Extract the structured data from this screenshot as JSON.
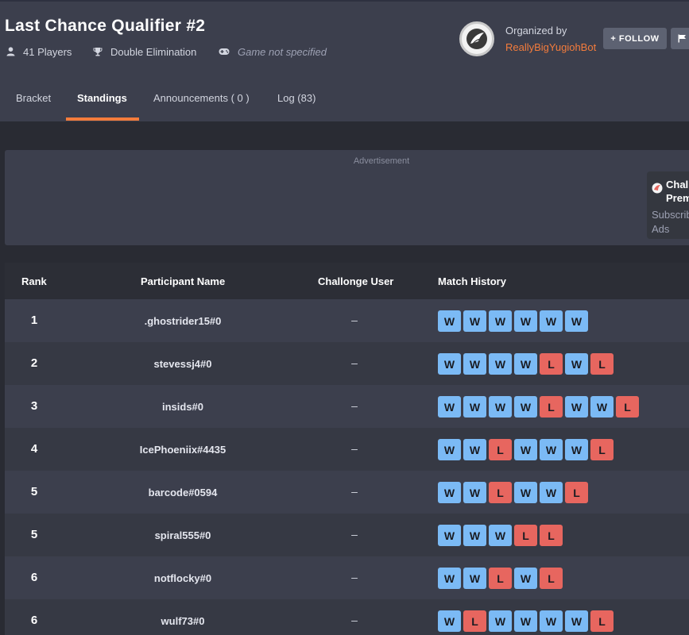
{
  "tournament": {
    "title": "Last Chance Qualifier #2",
    "players": "41 Players",
    "format": "Double Elimination",
    "game": "Game not specified"
  },
  "organizer": {
    "label": "Organized by",
    "name": "ReallyBigYugiohBot",
    "follow_label": "+ FOLLOW"
  },
  "tabs": [
    {
      "label": "Bracket",
      "active": false
    },
    {
      "label": "Standings",
      "active": true
    },
    {
      "label": "Announcements ( 0 )",
      "active": false
    },
    {
      "label": "Log (83)",
      "active": false
    }
  ],
  "ad": {
    "label": "Advertisement",
    "promo_title_1": "Chal",
    "promo_title_2": "Prem",
    "promo_sub_1": "Subscrib",
    "promo_sub_2": "Ads"
  },
  "standings": {
    "headers": {
      "rank": "Rank",
      "name": "Participant Name",
      "user": "Challonge User",
      "history": "Match History"
    },
    "rows": [
      {
        "rank": "1",
        "name": ".ghostrider15#0",
        "user": "–",
        "history": [
          "W",
          "W",
          "W",
          "W",
          "W",
          "W"
        ]
      },
      {
        "rank": "2",
        "name": "stevessj4#0",
        "user": "–",
        "history": [
          "W",
          "W",
          "W",
          "W",
          "L",
          "W",
          "L"
        ]
      },
      {
        "rank": "3",
        "name": "insids#0",
        "user": "–",
        "history": [
          "W",
          "W",
          "W",
          "W",
          "L",
          "W",
          "W",
          "L"
        ]
      },
      {
        "rank": "4",
        "name": "IcePhoeniix#4435",
        "user": "–",
        "history": [
          "W",
          "W",
          "L",
          "W",
          "W",
          "W",
          "L"
        ]
      },
      {
        "rank": "5",
        "name": "barcode#0594",
        "user": "–",
        "history": [
          "W",
          "W",
          "L",
          "W",
          "W",
          "L"
        ]
      },
      {
        "rank": "5",
        "name": "spiral555#0",
        "user": "–",
        "history": [
          "W",
          "W",
          "W",
          "L",
          "L"
        ]
      },
      {
        "rank": "6",
        "name": "notflocky#0",
        "user": "–",
        "history": [
          "W",
          "W",
          "L",
          "W",
          "L"
        ]
      },
      {
        "rank": "6",
        "name": "wulf73#0",
        "user": "–",
        "history": [
          "W",
          "L",
          "W",
          "W",
          "W",
          "W",
          "L"
        ]
      }
    ]
  },
  "colors": {
    "accent": "#f47c3c",
    "win": "#7bbaf5",
    "loss": "#e7665f"
  }
}
